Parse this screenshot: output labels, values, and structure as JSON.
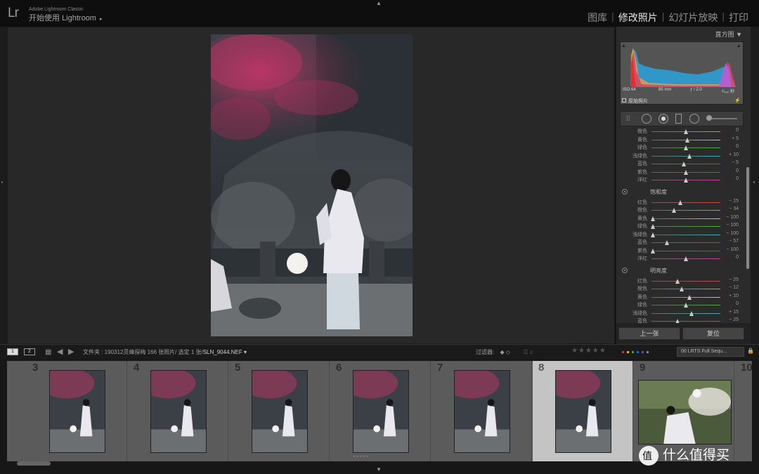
{
  "app": {
    "logo": "Lr",
    "subtitle": "Adobe Lightroom Classic",
    "title": "开始使用 Lightroom",
    "title_arrow": "▸"
  },
  "modules": [
    "图库",
    "修改照片",
    "幻灯片放映",
    "打印"
  ],
  "active_module": "修改照片",
  "histogram": {
    "header": "直方图 ▼",
    "iso": "ISO 64",
    "focal": "85 mm",
    "aperture": "ƒ / 2.0",
    "shutter": "¹⁄₄₀₀ 秒",
    "original_photo": "原始照片"
  },
  "hsl_partial": {
    "rows": [
      {
        "label": "橙色",
        "value": "0",
        "knob": 0.5,
        "color": "#e08a30"
      },
      {
        "label": "黄色",
        "value": "+ 5",
        "knob": 0.52,
        "color": "#d8c830"
      },
      {
        "label": "绿色",
        "value": "0",
        "knob": 0.5,
        "color": "#50b040"
      },
      {
        "label": "浅绿色",
        "value": "+ 10",
        "knob": 0.55,
        "color": "#40b0b0"
      },
      {
        "label": "蓝色",
        "value": "− 5",
        "knob": 0.47,
        "color": "#4060d0"
      },
      {
        "label": "紫色",
        "value": "0",
        "knob": 0.5,
        "color": "#8040c0"
      },
      {
        "label": "洋红",
        "value": "0",
        "knob": 0.5,
        "color": "#c040a0"
      }
    ]
  },
  "saturation": {
    "title": "饱和度",
    "rows": [
      {
        "label": "红色",
        "value": "− 15",
        "knob": 0.42,
        "color": "#d04040"
      },
      {
        "label": "橙色",
        "value": "− 34",
        "knob": 0.33,
        "color": "#e08a30"
      },
      {
        "label": "黄色",
        "value": "− 100",
        "knob": 0.02,
        "color": "#d8c830"
      },
      {
        "label": "绿色",
        "value": "− 100",
        "knob": 0.02,
        "color": "#50b040"
      },
      {
        "label": "浅绿色",
        "value": "− 100",
        "knob": 0.02,
        "color": "#40b0b0"
      },
      {
        "label": "蓝色",
        "value": "− 57",
        "knob": 0.22,
        "color": "#4060d0"
      },
      {
        "label": "紫色",
        "value": "− 100",
        "knob": 0.02,
        "color": "#8040c0"
      },
      {
        "label": "洋红",
        "value": "0",
        "knob": 0.5,
        "color": "#c040a0"
      }
    ]
  },
  "luminance": {
    "title": "明亮度",
    "rows": [
      {
        "label": "红色",
        "value": "− 25",
        "knob": 0.38,
        "color": "#d04040"
      },
      {
        "label": "橙色",
        "value": "− 12",
        "knob": 0.44,
        "color": "#e08a30"
      },
      {
        "label": "黄色",
        "value": "+ 10",
        "knob": 0.55,
        "color": "#d8c830"
      },
      {
        "label": "绿色",
        "value": "0",
        "knob": 0.5,
        "color": "#50b040"
      },
      {
        "label": "浅绿色",
        "value": "+ 15",
        "knob": 0.58,
        "color": "#40b0b0"
      },
      {
        "label": "蓝色",
        "value": "− 25",
        "knob": 0.38,
        "color": "#4060d0"
      }
    ]
  },
  "panel_buttons": {
    "previous": "上一张",
    "reset": "复位"
  },
  "toolbar": {
    "monitor1": "1",
    "monitor2": "2",
    "path_prefix": "文件夹 : 190312灵峰探梅   166 张照片/ 选定 1 张/",
    "filename": "SLN_9044.NEF ▾",
    "filter_label": "过滤器:",
    "stars": "★★★★★",
    "preset": "00 LRTS Full Sequ..."
  },
  "filmstrip": [
    {
      "num": "3",
      "orientation": "portrait",
      "selected": false,
      "stars": ""
    },
    {
      "num": "4",
      "orientation": "portrait",
      "selected": false,
      "stars": ""
    },
    {
      "num": "5",
      "orientation": "portrait",
      "selected": false,
      "stars": ""
    },
    {
      "num": "6",
      "orientation": "portrait",
      "selected": false,
      "stars": "★★★★★"
    },
    {
      "num": "7",
      "orientation": "portrait",
      "selected": false,
      "stars": ""
    },
    {
      "num": "8",
      "orientation": "portrait",
      "selected": true,
      "stars": ""
    },
    {
      "num": "9",
      "orientation": "landscape",
      "selected": false,
      "stars": ""
    },
    {
      "num": "10",
      "orientation": "portrait",
      "selected": false,
      "stars": ""
    }
  ],
  "watermark": "什么值得买"
}
